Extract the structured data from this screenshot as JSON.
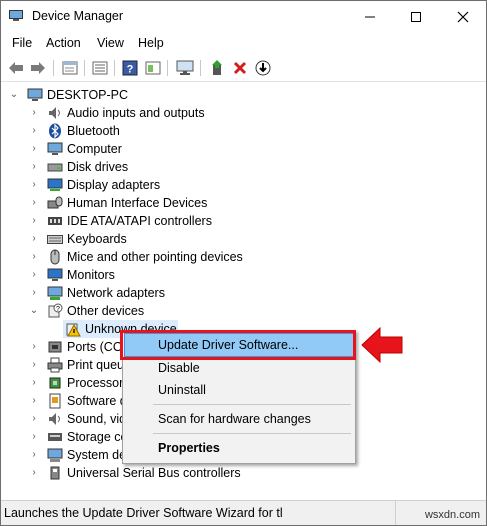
{
  "window": {
    "title": "Device Manager"
  },
  "menu": [
    "File",
    "Action",
    "View",
    "Help"
  ],
  "toolbar": [
    "back-icon",
    "forward-icon",
    "properties-icon",
    "list-icon",
    "help-icon",
    "view-icon",
    "monitor-icon",
    "update-driver-icon",
    "uninstall-icon",
    "download-icon"
  ],
  "tree": {
    "root": "DESKTOP-PC",
    "items": [
      "Audio inputs and outputs",
      "Bluetooth",
      "Computer",
      "Disk drives",
      "Display adapters",
      "Human Interface Devices",
      "IDE ATA/ATAPI controllers",
      "Keyboards",
      "Mice and other pointing devices",
      "Monitors",
      "Network adapters",
      "Other devices",
      "Unknown device",
      "Ports (COM",
      "Print queu",
      "Processors",
      "Software d",
      "Sound, vid",
      "Storage co",
      "System dev",
      "Universal Serial Bus controllers"
    ]
  },
  "context_menu": {
    "update": "Update Driver Software...",
    "disable": "Disable",
    "uninstall": "Uninstall",
    "scan": "Scan for hardware changes",
    "properties": "Properties"
  },
  "status": "Launches the Update Driver Software Wizard for tl",
  "watermark": "wsxdn.com",
  "colors": {
    "highlight": "#91c9f7",
    "annotation_red": "#e8141b"
  }
}
